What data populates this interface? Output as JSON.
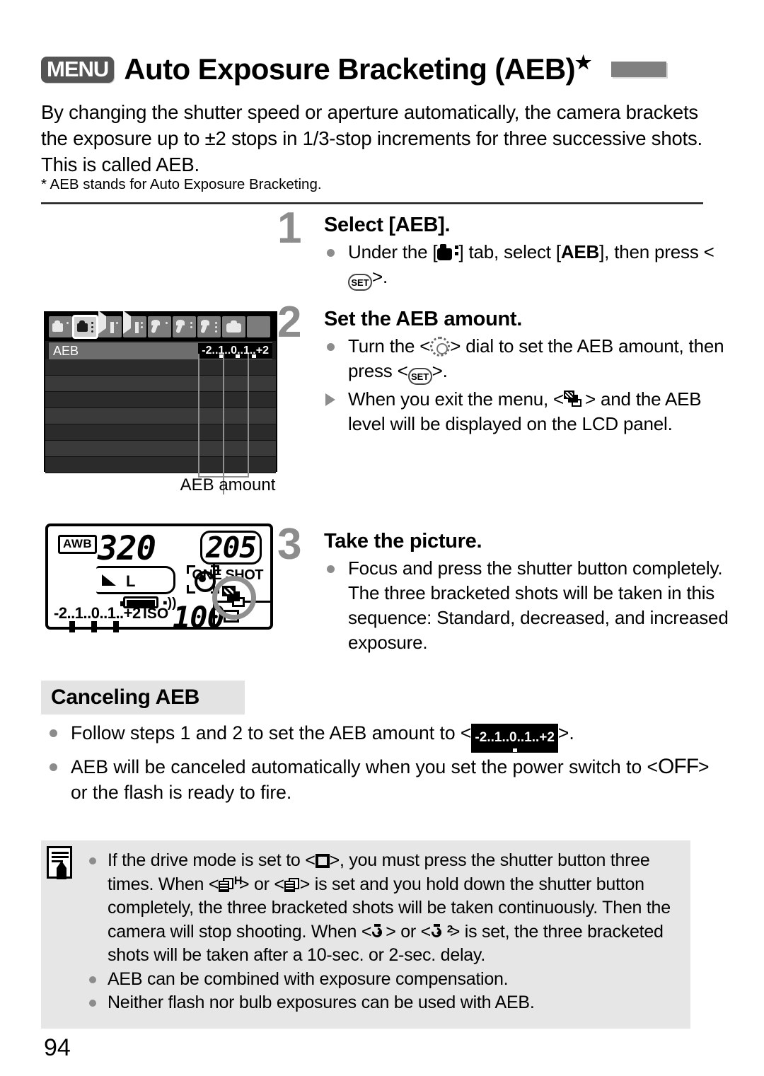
{
  "header": {
    "menu_badge": "MENU",
    "title": "Auto Exposure Bracketing (AEB)",
    "star": "★"
  },
  "intro": {
    "paragraph": "By changing the shutter speed or aperture automatically, the camera brackets the exposure up to ±2 stops in 1/3-stop increments for three successive shots. This is called AEB.",
    "footnote": "* AEB stands for Auto Exposure Bracketing."
  },
  "steps": [
    {
      "number": "1",
      "title": "Select [AEB].",
      "body_a": "Under the [",
      "body_b": "] tab, select [",
      "body_bold": "AEB",
      "body_c": "], then press <",
      "set_label": "SET",
      "body_d": ">."
    },
    {
      "number": "2",
      "title": "Set the AEB amount.",
      "bullet_a": "Turn the <",
      "bullet_b": "> dial to set the AEB amount, then press <",
      "set_label": "SET",
      "bullet_c": ">.",
      "tri_a": "When you exit the menu, <",
      "tri_b": "> and the AEB level will be displayed on the LCD panel."
    },
    {
      "number": "3",
      "title": "Take the picture.",
      "bullet": "Focus and press the shutter button completely. The three bracketed shots will be taken in this sequence: Standard, decreased, and increased exposure."
    }
  ],
  "menu_screen": {
    "tabs": [
      {
        "name": "shooting-tab-1",
        "type": "camera",
        "active": false
      },
      {
        "name": "shooting-tab-2",
        "type": "camera",
        "active": true
      },
      {
        "name": "playback-tab-1",
        "type": "play",
        "active": false
      },
      {
        "name": "playback-tab-2",
        "type": "play",
        "active": false
      },
      {
        "name": "setup-tab-1",
        "type": "wrench",
        "active": false
      },
      {
        "name": "setup-tab-2",
        "type": "wrench",
        "active": false
      },
      {
        "name": "setup-tab-3",
        "type": "wrench",
        "active": false
      },
      {
        "name": "custom-tab",
        "type": "plaincam",
        "active": false
      },
      {
        "name": "mymenu-tab",
        "type": "star",
        "active": false
      }
    ],
    "selected_row_label": "AEB",
    "aeb_scale_text": "-2..1..0..1..+2",
    "marker_count": 3,
    "caption": "AEB amount"
  },
  "lcd_panel": {
    "white_balance": "AWB",
    "shutter_speed": "320",
    "frames_remaining": "205",
    "quality_size": "L",
    "af_mode": "ONE SHOT",
    "iso_label": "ISO",
    "iso_value": "100",
    "exposure_scale": "-2..1..0..1..+2",
    "marker_count": 3,
    "highlighted_icon": "aeb-bracketing-icon"
  },
  "canceling": {
    "heading": "Canceling AEB",
    "items": [
      {
        "text_a": "Follow steps 1 and 2 to set the AEB amount to <",
        "scale": "-2..1..0..1..+2",
        "text_b": ">."
      },
      {
        "text_a": "AEB will be canceled automatically when you set the power switch to <",
        "off_label": "OFF",
        "text_b": "> or the flash is ready to fire."
      }
    ]
  },
  "notes": {
    "icon": "note-pencil-icon",
    "items": [
      {
        "a": "If the drive mode is set to <",
        "b": ">, you must press the shutter button three times. When <",
        "c": "> or <",
        "d": "> is set and you hold down the shutter button completely, the three bracketed shots will be taken continuously. Then the camera will stop shooting. When <",
        "e": "> or <",
        "f": "> is set, the three bracketed shots will be taken after a 10-sec. or 2-sec. delay.",
        "burst_h": "H",
        "timer_sub": "2"
      },
      {
        "text": "AEB can be combined with exposure compensation."
      },
      {
        "text": "Neither flash nor bulb exposures can be used with AEB."
      }
    ]
  },
  "page_number": "94",
  "colors": {
    "accent_gray": "#8c8c8c",
    "section_bg": "#e3e3e3",
    "notes_bg": "#e6e6e6"
  }
}
